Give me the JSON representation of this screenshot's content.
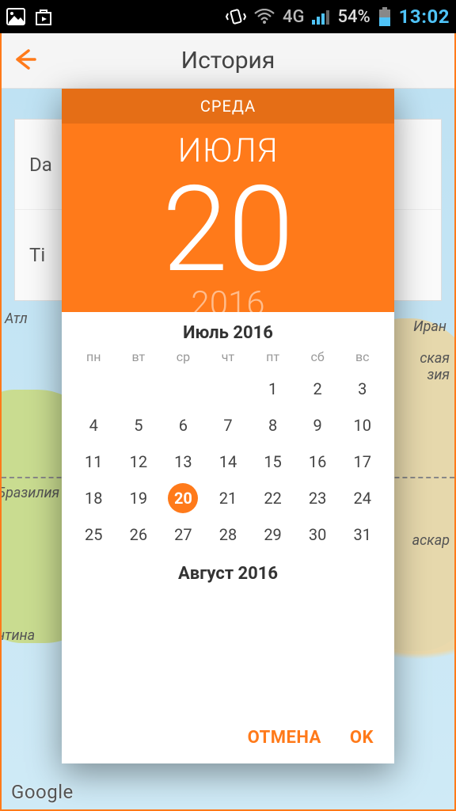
{
  "statusbar": {
    "network_label": "4G",
    "battery_pct": "54%",
    "clock": "13:02"
  },
  "header": {
    "title": "История"
  },
  "form_peek": {
    "row1": "Da",
    "row2": "Ti"
  },
  "map_labels": {
    "atlantic": "Атл",
    "iran": "Иран",
    "brazil": "Бразилия",
    "madagascar": "аскар",
    "argentina": "нтина",
    "asia_suffix": "ская\nзия"
  },
  "google": "Google",
  "datepicker": {
    "weekday": "СРЕДА",
    "month_upper": "ИЮЛЯ",
    "day": "20",
    "year": "2016",
    "current_month_title": "Июль 2016",
    "next_month_title": "Август 2016",
    "dow": [
      "пн",
      "вт",
      "ср",
      "чт",
      "пт",
      "сб",
      "вс"
    ],
    "weeks": [
      [
        "",
        "",
        "",
        "",
        "1",
        "2",
        "3"
      ],
      [
        "4",
        "5",
        "6",
        "7",
        "8",
        "9",
        "10"
      ],
      [
        "11",
        "12",
        "13",
        "14",
        "15",
        "16",
        "17"
      ],
      [
        "18",
        "19",
        "20",
        "21",
        "22",
        "23",
        "24"
      ],
      [
        "25",
        "26",
        "27",
        "28",
        "29",
        "30",
        "31"
      ]
    ],
    "selected_day": "20"
  },
  "actions": {
    "cancel": "ОТМЕНА",
    "ok": "OK"
  },
  "colors": {
    "accent": "#ff7a1a",
    "accent_dark": "#e56e16"
  }
}
